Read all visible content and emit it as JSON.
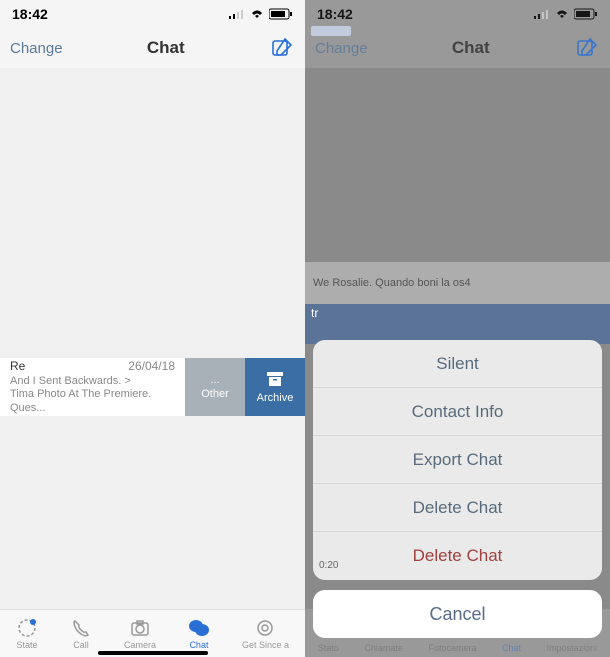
{
  "status": {
    "time": "18:42",
    "signal_alt": "signal",
    "wifi_alt": "wifi",
    "battery_alt": "battery"
  },
  "left_pane": {
    "nav": {
      "left_label": "Change",
      "title": "Chat",
      "compose_alt": "compose"
    },
    "chat_row": {
      "name": "Re",
      "date": "26/04/18",
      "preview_line1": "And I Sent Backwards. >",
      "preview_line2": "Tima Photo At The Premiere. Ques...",
      "swipe_other": "Other",
      "swipe_archive": "Archive",
      "swipe_other_dots": "..."
    },
    "tabs": {
      "state": "State",
      "call": "Call",
      "camera": "Camera",
      "chat": "Chat",
      "settings": "Get Since a"
    }
  },
  "right_pane": {
    "nav": {
      "left_label": "Change",
      "title": "Chat"
    },
    "blurred_text": "We Rosalie. Quando boni la os4",
    "blurred_name": "tr",
    "action_sheet": {
      "silent": "Silent",
      "contact_info": "Contact Info",
      "export_chat": "Export Chat",
      "delete_chat1": "Delete Chat",
      "delete_chat2": "Delete Chat",
      "cancel": "Cancel"
    },
    "blurry_meta": "0:20",
    "tabs": {
      "stato": "Stato",
      "chiamate": "Chiamate",
      "fotocamera": "Fotocamera",
      "chat": "Chat",
      "impostazioni": "Impostazioni"
    }
  },
  "colors": {
    "accent": "#2a6fd6",
    "archive": "#3a6ea5"
  }
}
